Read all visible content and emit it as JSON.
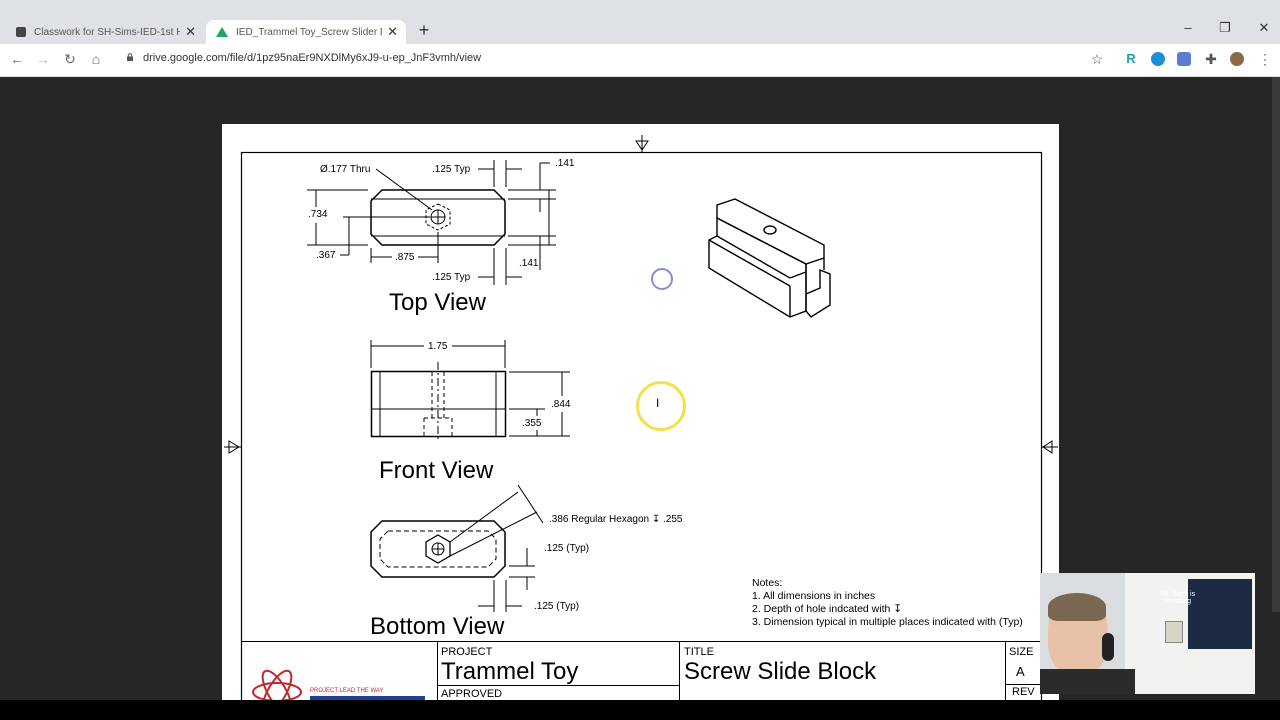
{
  "browser": {
    "tabs": [
      {
        "title": "Classwork for SH-Sims-IED-1st H",
        "active": false
      },
      {
        "title": "IED_Trammel Toy_Screw Slider D",
        "active": true
      }
    ],
    "url": "drive.google.com/file/d/1pz95naEr9NXDlMy6xJ9-u-ep_JnF3vmh/view"
  },
  "drawing": {
    "top_view": {
      "title": "Top View",
      "dims": {
        "hole": "Ø.177 Thru",
        "typ_top": ".125 Typ",
        "d141_top": ".141",
        "d734": ".734",
        "d367": ".367",
        "d875": ".875",
        "typ_bottom": ".125 Typ",
        "d141_bottom": ".141"
      }
    },
    "front_view": {
      "title": "Front View",
      "dims": {
        "width": "1.75",
        "height": ".844",
        "step": ".355"
      }
    },
    "bottom_view": {
      "title": "Bottom View",
      "dims": {
        "hexagon": ".386 Regular Hexagon ↧ .255",
        "typ_right": ".125 (Typ)",
        "typ_bottom": ".125 (Typ)"
      }
    },
    "notes": {
      "heading": "Notes:",
      "items": [
        "1. All dimensions in inches",
        "2. Depth of hole indcated with ↧",
        "3. Dimension typical in multiple places indicated with (Typ)"
      ]
    },
    "title_block": {
      "project_label": "PROJECT",
      "project_value": "Trammel Toy",
      "approved_label": "APPROVED",
      "title_label": "TITLE",
      "title_value": "Screw Slide Block",
      "size_label": "SIZE",
      "size_value": "A",
      "rev_label": "REV",
      "logo_tagline": "PROJECT LEAD THE WAY"
    }
  },
  "webcam": {
    "pennant_text": "Mr. Sims is Reading"
  },
  "colors": {
    "tabbar": "#dee1e6",
    "viewer_bg": "#262626",
    "cursor_ring": "#f4e04d",
    "cursor_ring_blue": "#8a8ad8"
  },
  "icons": [
    "close-icon",
    "plus-icon",
    "back-icon",
    "forward-icon",
    "reload-icon",
    "home-icon",
    "lock-icon",
    "star-icon",
    "extension-icon",
    "menu-icon"
  ]
}
